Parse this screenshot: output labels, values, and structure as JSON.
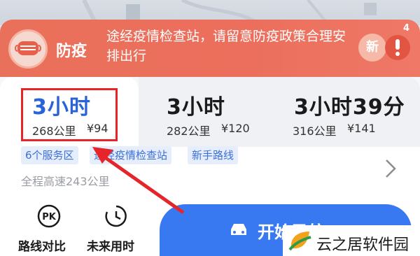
{
  "banner": {
    "label": "防疫",
    "message": "途经疫情检查站，请留意防疫政策合理安排出行",
    "new_label": "新",
    "alert_count": "4"
  },
  "routes": [
    {
      "time": "3小时",
      "distance": "268公里",
      "price": "¥94",
      "selected": true
    },
    {
      "time": "3小时",
      "distance": "282公里",
      "price": "¥120",
      "selected": false
    },
    {
      "time": "3小时39分",
      "distance": "316公里",
      "price": "¥141",
      "selected": false
    }
  ],
  "tags": [
    "6个服务区",
    "途经疫情检查站",
    "新手路线"
  ],
  "summary": "全程高速243公里",
  "tools": [
    {
      "label": "路线对比",
      "icon": "pk-icon"
    },
    {
      "label": "未来用时",
      "icon": "future-time-icon"
    }
  ],
  "start_button": {
    "label": "开始导航"
  },
  "watermark": {
    "text": "云之居软件园"
  },
  "colors": {
    "accent": "#2a63d8",
    "banner": "#ec6f5d",
    "button": "#3879f2",
    "highlight": "#e5252a"
  }
}
